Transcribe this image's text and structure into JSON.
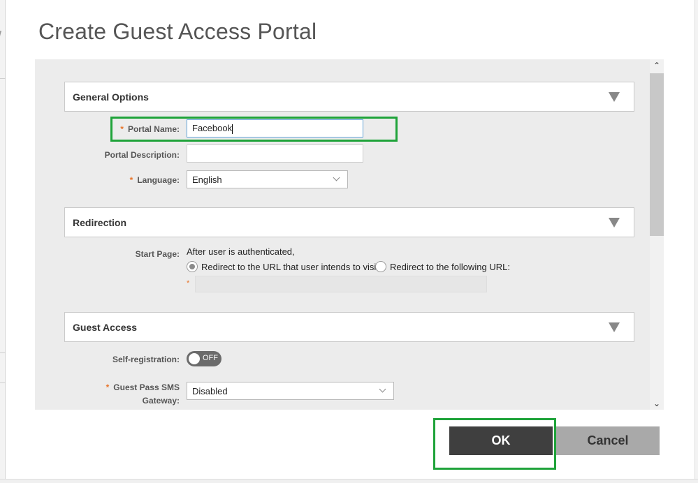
{
  "dialog": {
    "title": "Create Guest Access Portal"
  },
  "sections": {
    "general": {
      "title": "General Options",
      "portal_name_label": "Portal Name:",
      "portal_name_value": "Facebook",
      "portal_description_label": "Portal Description:",
      "portal_description_value": "",
      "language_label": "Language:",
      "language_value": "English"
    },
    "redirection": {
      "title": "Redirection",
      "start_page_label": "Start Page:",
      "start_page_note": "After user is authenticated,",
      "option_intended": "Redirect to the URL that user intends to visit.",
      "option_following": "Redirect to the following URL:",
      "selected_option": "intended",
      "url_value": ""
    },
    "guest_access": {
      "title": "Guest Access",
      "self_registration_label": "Self-registration:",
      "self_registration_state": "OFF",
      "sms_gateway_label_line1": "Guest Pass SMS",
      "sms_gateway_label_line2": "Gateway:",
      "sms_gateway_value": "Disabled"
    }
  },
  "footer": {
    "ok_label": "OK",
    "cancel_label": "Cancel"
  },
  "colors": {
    "highlight": "#1fa33a",
    "required_marker": "#e8772e",
    "ok_button": "#3f3f3f",
    "cancel_button": "#a9a9a9"
  },
  "icons": {
    "section_toggle": "triangle-down-icon",
    "select_caret": "chevron-down-icon",
    "scroll_up": "chevron-up-icon",
    "scroll_down": "chevron-down-icon"
  }
}
